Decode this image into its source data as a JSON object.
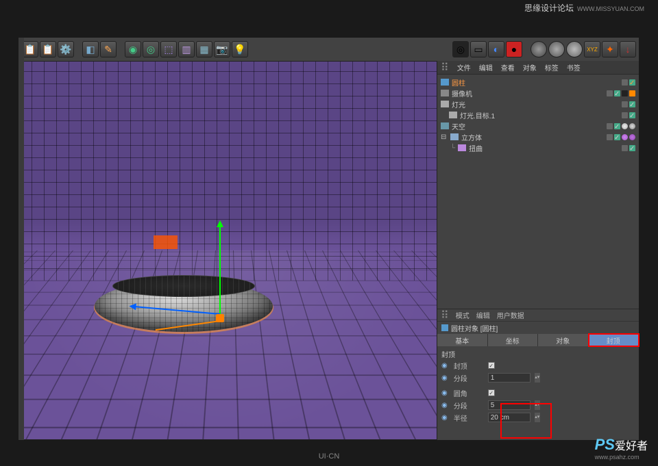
{
  "watermarks": {
    "top_left": "思缘设计论坛",
    "top_left_url": "WWW.MISSYUAN.COM",
    "bottom_ps": "PS",
    "bottom_cn": "爱好者",
    "bottom_url": "www.psahz.com",
    "center": "UI·CN"
  },
  "obj_tabs": [
    "文件",
    "编辑",
    "查看",
    "对象",
    "标签",
    "书签"
  ],
  "tree": [
    {
      "label": "圆柱",
      "selected": true,
      "icon": "cyl",
      "indent": 0
    },
    {
      "label": "摄像机",
      "icon": "cam",
      "indent": 0
    },
    {
      "label": "灯光",
      "icon": "light",
      "indent": 0
    },
    {
      "label": "灯光.目标.1",
      "icon": "light",
      "indent": 1
    },
    {
      "label": "天空",
      "icon": "sky",
      "indent": 0
    },
    {
      "label": "立方体",
      "icon": "cube",
      "indent": 0,
      "expand": true
    },
    {
      "label": "扭曲",
      "icon": "cube",
      "indent": 1
    }
  ],
  "attr_top_tabs": [
    "模式",
    "编辑",
    "用户数据"
  ],
  "attr_title": "圆柱对象 [圆柱]",
  "attr_subtabs": [
    {
      "label": "基本"
    },
    {
      "label": "坐标"
    },
    {
      "label": "对象"
    },
    {
      "label": "封顶",
      "active": true,
      "highlight": true
    }
  ],
  "caps": {
    "section": "封顶",
    "enable_label": "封顶",
    "enable_checked": true,
    "seg_label": "分段",
    "seg_value": "1",
    "fillet_label": "圆角",
    "fillet_checked": true,
    "fillet_seg_label": "分段",
    "fillet_seg_value": "5",
    "radius_label": "半径",
    "radius_value": "20 cm"
  }
}
